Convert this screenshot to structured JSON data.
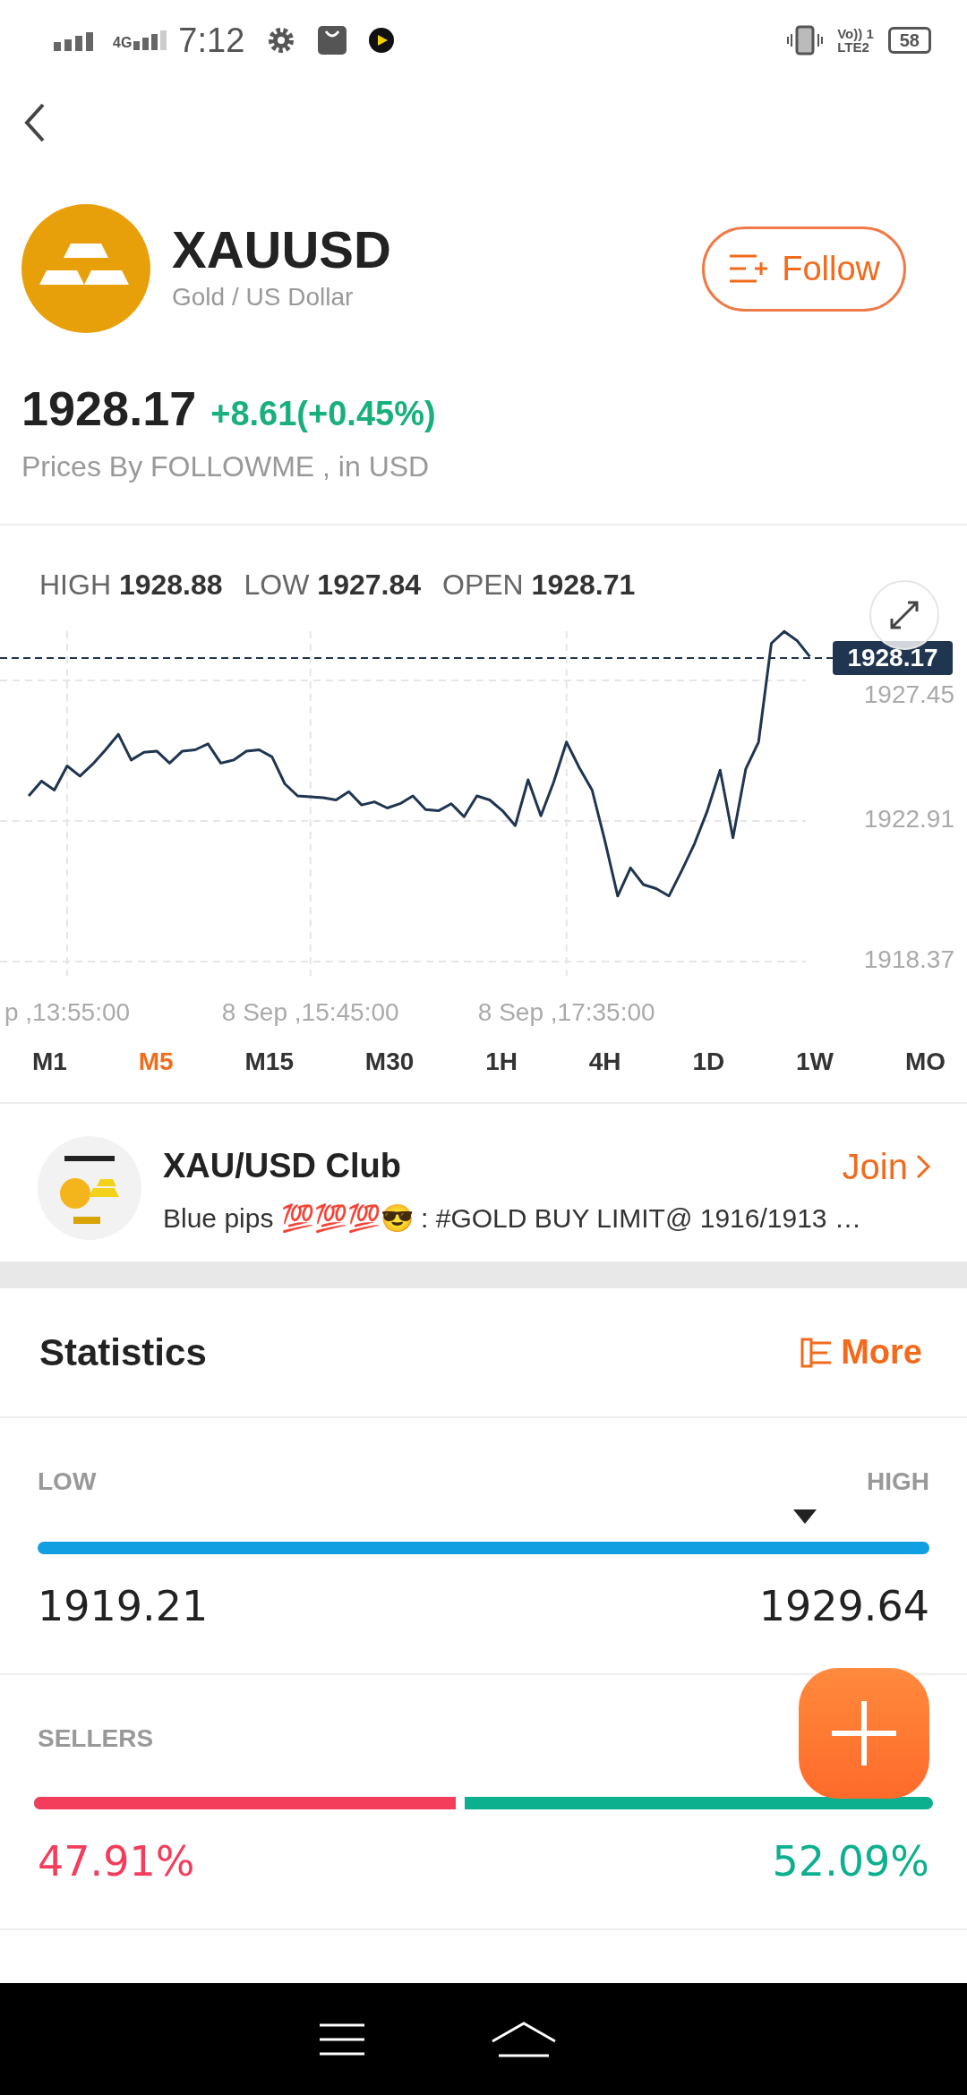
{
  "status_bar": {
    "network": "4G",
    "time": "7:12",
    "volte": [
      "Vo)) 1",
      "LTE2"
    ],
    "battery": "58"
  },
  "instrument": {
    "symbol": "XAUUSD",
    "name": "Gold / US Dollar",
    "follow_label": "Follow",
    "price": "1928.17",
    "change": "+8.61(+0.45%)",
    "source": "Prices By FOLLOWME , in USD"
  },
  "ohlc": [
    {
      "label": "HIGH",
      "value": "1928.88"
    },
    {
      "label": "LOW",
      "value": "1927.84"
    },
    {
      "label": "OPEN",
      "value": "1928.71"
    }
  ],
  "chart": {
    "chart_data": {
      "type": "line",
      "categories": [
        null,
        null,
        null,
        "p ,13:55:00",
        null,
        null,
        null,
        null,
        null,
        null,
        null,
        null,
        null,
        null,
        null,
        null,
        null,
        null,
        null,
        null,
        null,
        null,
        "8 Sep ,15:45:00",
        null,
        null,
        null,
        null,
        null,
        null,
        null,
        null,
        null,
        null,
        null,
        null,
        null,
        null,
        null,
        null,
        null,
        null,
        null,
        "8 Sep ,17:35:00",
        null,
        null,
        null,
        null,
        null,
        null,
        null,
        null,
        null,
        null,
        null,
        null,
        null,
        null,
        null,
        null,
        null,
        null,
        null
      ],
      "series": [
        {
          "color": "#1f3550",
          "values": [
            1923.72,
            1924.2,
            1923.91,
            1924.69,
            1924.36,
            1924.75,
            1925.21,
            1925.71,
            1924.88,
            1925.13,
            1925.17,
            1924.78,
            1925.17,
            1925.21,
            1925.4,
            1924.78,
            1924.88,
            1925.17,
            1925.21,
            1924.98,
            1924.11,
            1923.72,
            1923.69,
            1923.66,
            1923.59,
            1923.86,
            1923.43,
            1923.53,
            1923.33,
            1923.47,
            1923.72,
            1923.28,
            1923.24,
            1923.47,
            1923.05,
            1923.72,
            1923.59,
            1923.24,
            1922.76,
            1924.24,
            1923.08,
            1924.17,
            1925.46,
            1924.63,
            1923.91,
            1922.27,
            1920.49,
            1921.4,
            1920.86,
            1920.73,
            1920.49,
            1921.31,
            1922.18,
            1923.24,
            1924.55,
            1922.37,
            1924.59,
            1925.46,
            1928.65,
            1929.03,
            1928.74,
            1928.22
          ]
        }
      ],
      "ylim": [
        1917.91,
        1929.04
      ],
      "yticks": [
        1918.37,
        1922.91,
        1927.45
      ],
      "grid": true
    },
    "last_price_label": "1928.17"
  },
  "timeframes": [
    {
      "label": "M1",
      "selected": false
    },
    {
      "label": "M5",
      "selected": true
    },
    {
      "label": "M15",
      "selected": false
    },
    {
      "label": "M30",
      "selected": false
    },
    {
      "label": "1H",
      "selected": false
    },
    {
      "label": "4H",
      "selected": false
    },
    {
      "label": "1D",
      "selected": false
    },
    {
      "label": "1W",
      "selected": false
    },
    {
      "label": "MO",
      "selected": false
    }
  ],
  "club": {
    "title": "XAU/USD Club",
    "message": "Blue pips 💯💯💯😎 : #GOLD BUY LIMIT@ 1916/1913 …",
    "join_label": "Join"
  },
  "statistics": {
    "title": "Statistics",
    "more_label": "More",
    "range": {
      "low_label": "LOW",
      "high_label": "HIGH",
      "level": 0.86,
      "low": "1919.21",
      "high": "1929.64"
    },
    "sentiment": {
      "label": "SELLERS",
      "level": 0.4791,
      "sellers": "47.91%",
      "buyers": "52.09%"
    }
  }
}
